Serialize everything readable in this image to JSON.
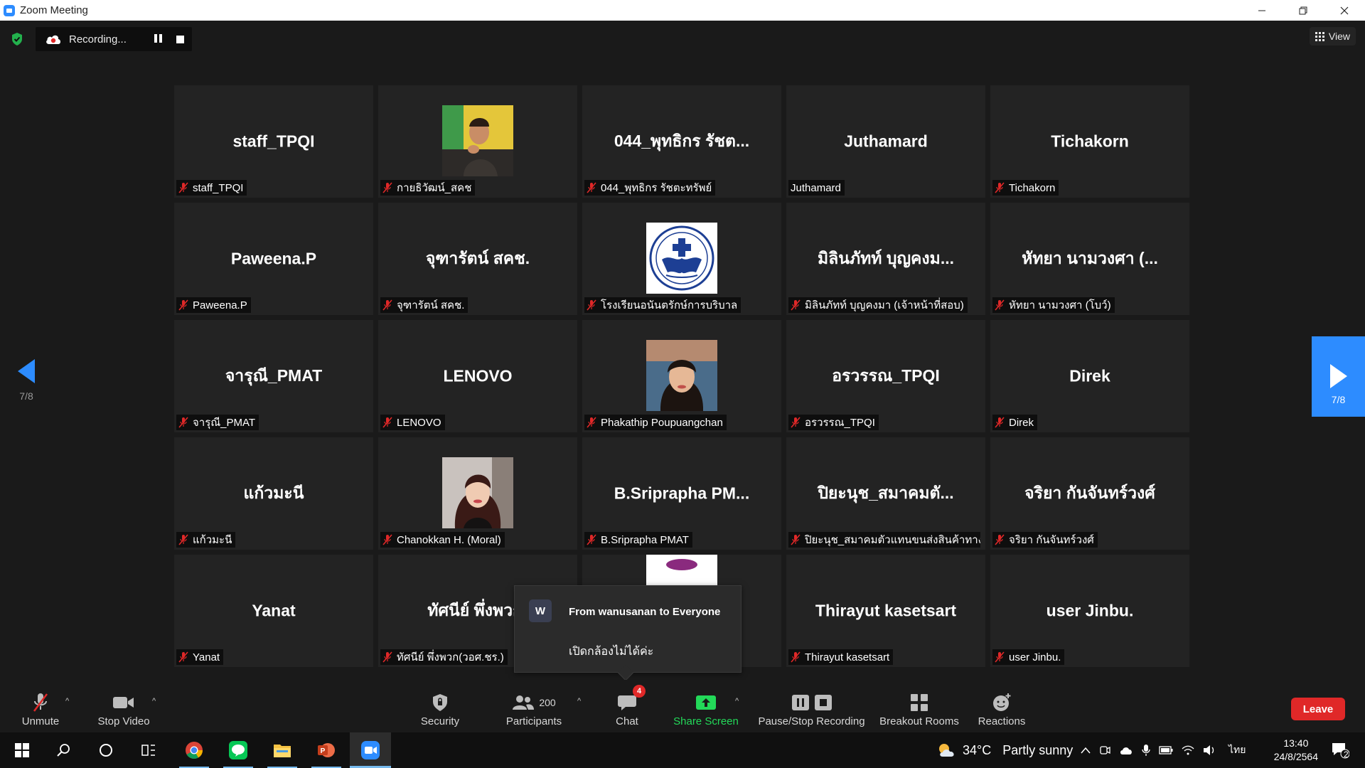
{
  "window": {
    "title": "Zoom Meeting"
  },
  "recording": {
    "label": "Recording..."
  },
  "view": {
    "label": "View"
  },
  "tiles": [
    {
      "big": "staff_TPQI",
      "tag": "staff_TPQI",
      "photo": null
    },
    {
      "big": "",
      "tag": "กายธิวัฒน์_สคช",
      "photo": "man-yellow"
    },
    {
      "big": "044_พุทธิกร รัชต...",
      "tag": "044_พุทธิกร รัชตะทรัพย์",
      "photo": null
    },
    {
      "big": "Juthamard",
      "tag": "Juthamard",
      "photo": null,
      "nomic": true
    },
    {
      "big": "Tichakorn",
      "tag": "Tichakorn",
      "photo": null
    },
    {
      "big": "Paweena.P",
      "tag": "Paweena.P",
      "photo": null
    },
    {
      "big": "จุฑารัตน์ สคช.",
      "tag": "จุฑารัตน์ สคช.",
      "photo": null
    },
    {
      "big": "",
      "tag": "โรงเรียนอนันตรักษ์การบริบาล",
      "photo": "school-logo"
    },
    {
      "big": "มิลินภัทท์ บุญคงม...",
      "tag": "มิลินภัทท์ บุญคงมา (เจ้าหน้าที่สอบ)",
      "photo": null
    },
    {
      "big": "หัทยา นามวงศา (...",
      "tag": "หัทยา นามวงศา (โบว์)",
      "photo": null
    },
    {
      "big": "จารุณี_PMAT",
      "tag": "จารุณี_PMAT",
      "photo": null
    },
    {
      "big": "LENOVO",
      "tag": "LENOVO",
      "photo": null
    },
    {
      "big": "",
      "tag": "Phakathip Poupuangchan",
      "photo": "woman-1"
    },
    {
      "big": "อรวรรณ_TPQI",
      "tag": "อรวรรณ_TPQI",
      "photo": null
    },
    {
      "big": "Direk",
      "tag": "Direk",
      "photo": null
    },
    {
      "big": "แก้วมะนี",
      "tag": "แก้วมะนี",
      "photo": null
    },
    {
      "big": "",
      "tag": "Chanokkan H. (Moral)",
      "photo": "woman-2"
    },
    {
      "big": "B.Sriprapha  PM...",
      "tag": "B.Sriprapha PMAT",
      "photo": null
    },
    {
      "big": "ปิยะนุช_สมาคมตั...",
      "tag": "ปิยะนุช_สมาคมตัวแทนขนส่งสินค้าทางอ...",
      "photo": null
    },
    {
      "big": "จริยา กันจันทร์วงศ์",
      "tag": "จริยา กันจันทร์วงศ์",
      "photo": null
    },
    {
      "big": "Yanat",
      "tag": "Yanat",
      "photo": null
    },
    {
      "big": "ทัศนีย์ พึ่งพวก(",
      "tag": "ทัศนีย์ พึ่งพวก(วอศ.ชร.)",
      "photo": null
    },
    {
      "big": "",
      "tag": "",
      "photo": "purple-partial",
      "hidden_tag": true
    },
    {
      "big": "Thirayut kasetsart",
      "tag": "Thirayut kasetsart",
      "photo": null
    },
    {
      "big": "user Jinbu.",
      "tag": "user Jinbu.",
      "photo": null
    }
  ],
  "pager": {
    "left": "7/8",
    "right": "7/8"
  },
  "chat_popup": {
    "avatar_letter": "W",
    "from": "From wanusanan to Everyone",
    "message": "เปิดกล้องไม่ได้ค่ะ"
  },
  "toolbar": {
    "unmute": "Unmute",
    "stop_video": "Stop Video",
    "security": "Security",
    "participants": "Participants",
    "participants_count": "200",
    "chat": "Chat",
    "chat_badge": "4",
    "share_screen": "Share Screen",
    "pause_stop_recording": "Pause/Stop Recording",
    "breakout_rooms": "Breakout Rooms",
    "reactions": "Reactions",
    "leave": "Leave"
  },
  "taskbar": {
    "weather_temp": "34°C",
    "weather_desc": "Partly sunny",
    "language": "ไทย",
    "time": "13:40",
    "date": "24/8/2564",
    "notif_count": "2"
  },
  "colors": {
    "accent": "#2d8cff",
    "leave": "#e02828",
    "share": "#23d959",
    "mic_off": "#e02828"
  }
}
